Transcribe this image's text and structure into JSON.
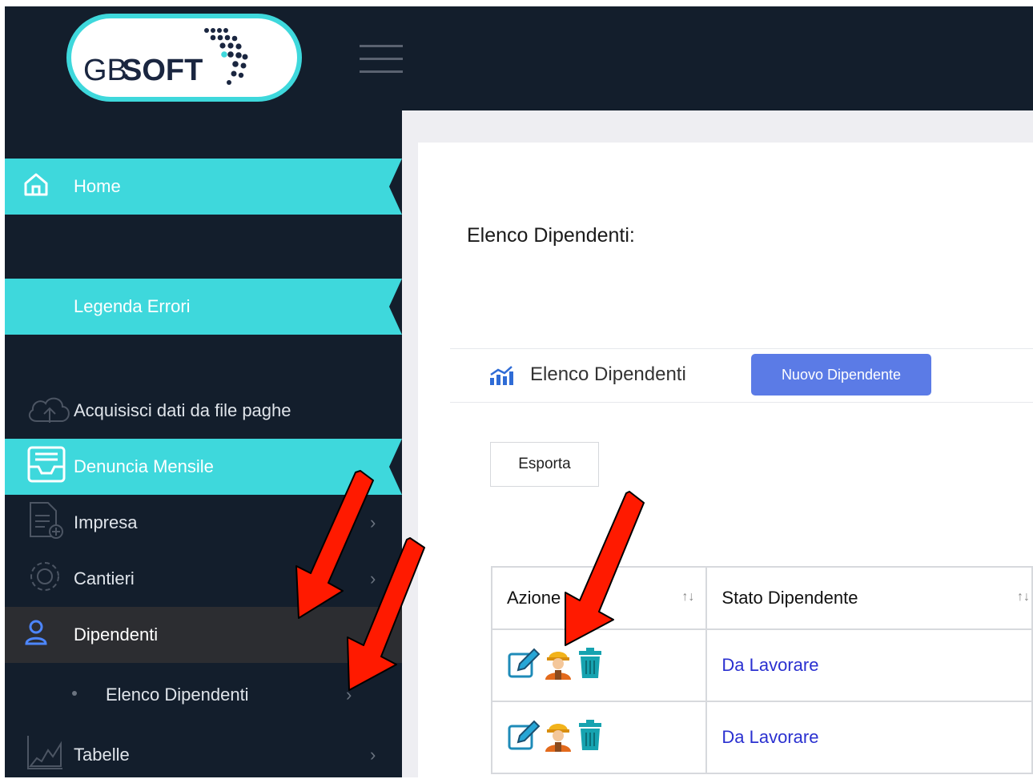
{
  "app": {
    "logo_text_gb": "GB",
    "logo_text_soft": "SOFT"
  },
  "sidebar": {
    "items": [
      {
        "label": "Home",
        "icon": "home-icon"
      },
      {
        "label": "Legenda Errori"
      },
      {
        "label": "Acquisisci dati da file paghe",
        "icon": "cloud-upload-icon"
      },
      {
        "label": "Denuncia Mensile",
        "icon": "inbox-tray-icon"
      },
      {
        "label": "Impresa",
        "icon": "document-add-icon"
      },
      {
        "label": "Cantieri",
        "icon": "gear-icon"
      },
      {
        "label": "Dipendenti",
        "icon": "user-icon"
      },
      {
        "label": "Elenco Dipendenti"
      },
      {
        "label": "Tabelle",
        "icon": "chart-area-icon"
      }
    ]
  },
  "main": {
    "heading": "Elenco Dipendenti:",
    "panel_title": "Elenco Dipendenti",
    "new_button": "Nuovo Dipendente",
    "export_button": "Esporta",
    "table": {
      "columns": [
        "Azione",
        "Stato Dipendente"
      ],
      "rows": [
        {
          "stato": "Da Lavorare"
        },
        {
          "stato": "Da Lavorare"
        }
      ]
    }
  },
  "colors": {
    "sidebar_bg": "#131e2c",
    "teal_accent": "#3ed8dc",
    "primary_button": "#5b7be6",
    "link": "#2a30d0",
    "annotation_arrow": "#ff0000"
  }
}
